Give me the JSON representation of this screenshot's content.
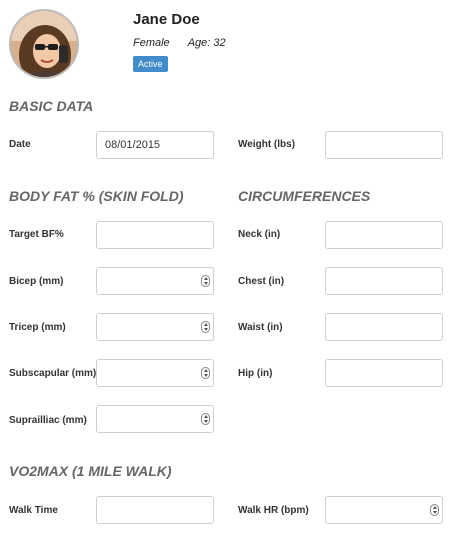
{
  "profile": {
    "name": "Jane Doe",
    "gender": "Female",
    "age": "Age: 32",
    "status": "Active"
  },
  "sections": {
    "basic": "BASIC DATA",
    "bodyfat": "BODY FAT % (SKIN FOLD)",
    "circ": "CIRCUMFERENCES",
    "vo2": "VO2MAX (1 MILE WALK)"
  },
  "fields": {
    "date": {
      "label": "Date",
      "value": "08/01/2015"
    },
    "weight": {
      "label": "Weight (lbs)",
      "value": ""
    },
    "target_bf": {
      "label": "Target BF%",
      "value": ""
    },
    "bicep": {
      "label": "Bicep (mm)",
      "value": ""
    },
    "tricep": {
      "label": "Tricep (mm)",
      "value": ""
    },
    "subscapular": {
      "label": "Subscapular (mm)",
      "value": ""
    },
    "suprailliac": {
      "label": "Suprailliac (mm)",
      "value": ""
    },
    "neck": {
      "label": "Neck (in)",
      "value": ""
    },
    "chest": {
      "label": "Chest (in)",
      "value": ""
    },
    "waist": {
      "label": "Waist (in)",
      "value": ""
    },
    "hip": {
      "label": "Hip (in)",
      "value": ""
    },
    "walk_time": {
      "label": "Walk Time",
      "value": ""
    },
    "walk_hr": {
      "label": "Walk HR (bpm)",
      "value": ""
    }
  }
}
